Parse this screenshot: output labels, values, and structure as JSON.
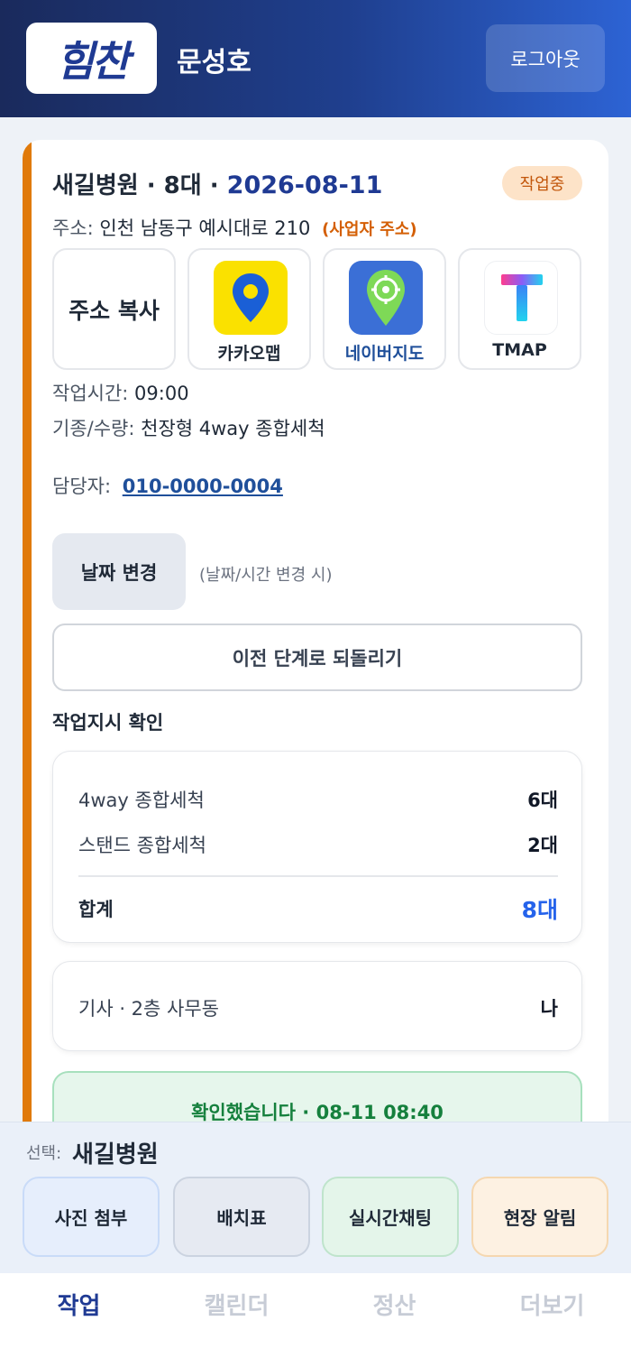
{
  "header": {
    "logo_text": "힘찬",
    "user_name": "문성호",
    "logout_label": "로그아웃"
  },
  "job": {
    "title_prefix": "새길병원 · 8대 · ",
    "date": "2026-08-11",
    "status": "작업중",
    "address_label": "주소:",
    "address": "인천 남동구 예시대로 210",
    "address_note": "(사업자 주소)",
    "copy_address_label": "주소 복사",
    "map_apps": [
      {
        "label": "카카오맵",
        "icon": "kakaomap-icon",
        "color": "#fae100"
      },
      {
        "label": "네이버지도",
        "icon": "navermap-icon",
        "color": "#3b6fd6"
      },
      {
        "label": "TMAP",
        "icon": "tmap-icon",
        "color": "#1f2937"
      }
    ],
    "time_label": "작업시간:",
    "time": "09:00",
    "model_label": "기종/수량:",
    "model": "천장형 4way 종합세척",
    "contact_label": "담당자:",
    "contact_phone": "010-0000-0004",
    "date_change_label": "날짜 변경",
    "date_change_hint": "(날짜/시간 변경 시)",
    "revert_label": "이전 단계로 되돌리기"
  },
  "work_order": {
    "title": "작업지시 확인",
    "items": [
      {
        "name": "4way 종합세척",
        "qty": "6대"
      },
      {
        "name": "스탠드 종합세척",
        "qty": "2대"
      }
    ],
    "total_label": "합계",
    "total_qty": "8대"
  },
  "location": {
    "label": "기사 · 2층 사무동",
    "value": "나"
  },
  "confirm": {
    "text": "확인했습니다 · 08-11 08:40"
  },
  "selection": {
    "label": "선택:",
    "name": "새길병원"
  },
  "actions": [
    "사진 첨부",
    "배치표",
    "실시간채팅",
    "현장 알림"
  ],
  "tabs": [
    {
      "label": "작업",
      "active": true
    },
    {
      "label": "캘린더",
      "active": false
    },
    {
      "label": "정산",
      "active": false
    },
    {
      "label": "더보기",
      "active": false
    }
  ],
  "colors": {
    "accent": "#e07a0a",
    "brand": "#1f3a93",
    "link": "#2563eb",
    "success": "#15803d"
  }
}
